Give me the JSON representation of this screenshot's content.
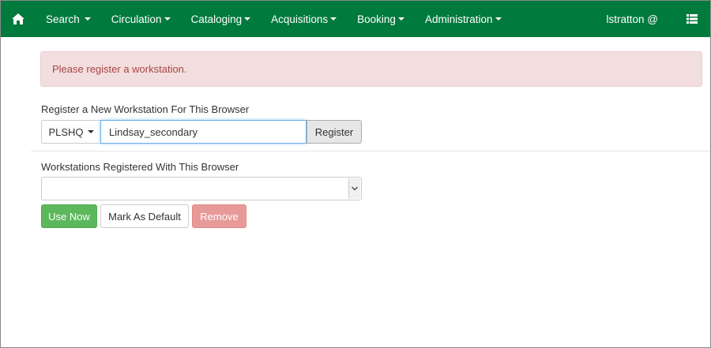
{
  "navbar": {
    "home_icon": "home-icon",
    "items": [
      {
        "label": "Search"
      },
      {
        "label": "Circulation"
      },
      {
        "label": "Cataloging"
      },
      {
        "label": "Acquisitions"
      },
      {
        "label": "Booking"
      },
      {
        "label": "Administration"
      }
    ],
    "user": "lstratton @",
    "menu_icon": "list-icon",
    "background_color": "#007a3d"
  },
  "alert": {
    "message": "Please register a workstation.",
    "background_color": "#f2dede",
    "text_color": "#a94442"
  },
  "register": {
    "heading": "Register a New Workstation For This Browser",
    "library": "PLSHQ",
    "workstation_name": "Lindsay_secondary",
    "button_label": "Register"
  },
  "registered": {
    "heading": "Workstations Registered With This Browser",
    "selected_value": "",
    "buttons": {
      "use_now": "Use Now",
      "mark_default": "Mark As Default",
      "remove": "Remove"
    },
    "colors": {
      "use_now": "#5cb85c",
      "remove": "#e89a98"
    }
  }
}
